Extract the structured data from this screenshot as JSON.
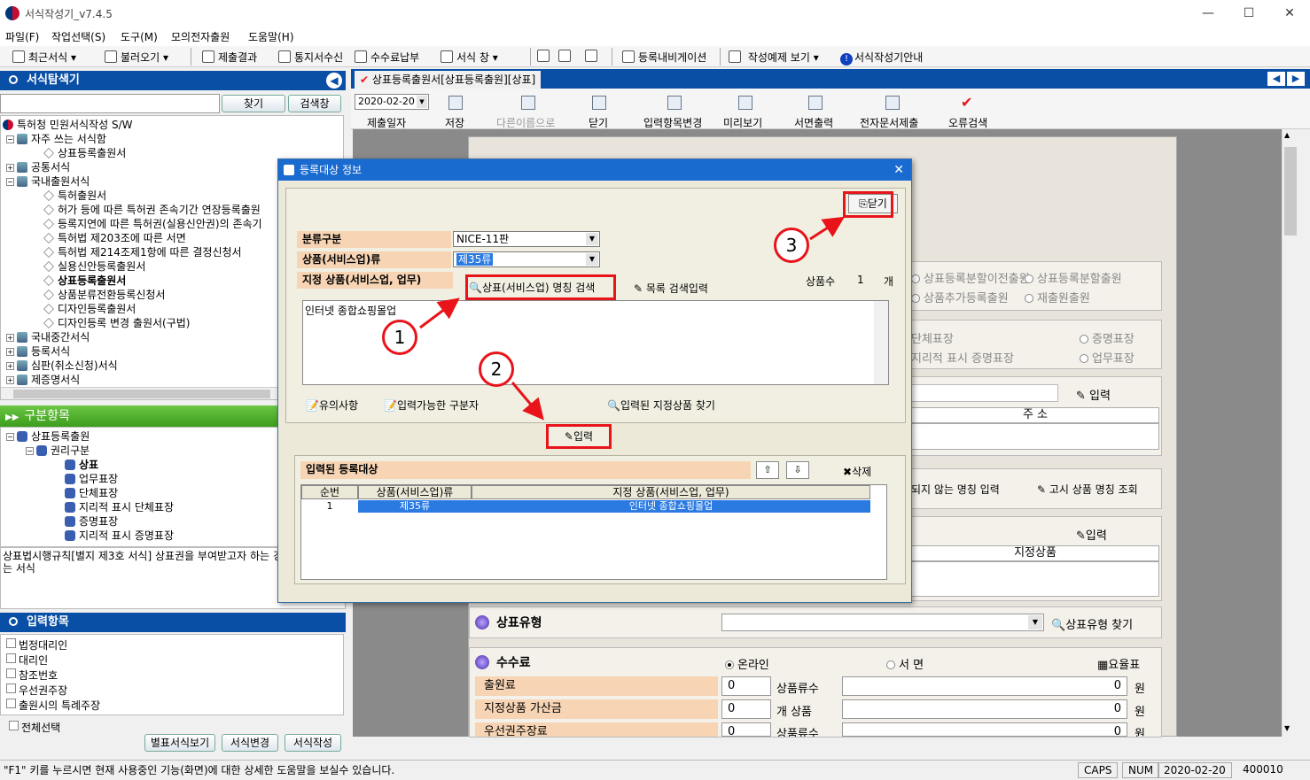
{
  "app": {
    "title": "서식작성기_v7.4.5"
  },
  "window_controls": {
    "minimize": "—",
    "maximize": "☐",
    "close": "✕"
  },
  "menu": [
    "파일(F)",
    "작업선택(S)",
    "도구(M)",
    "모의전자출원",
    "도움말(H)"
  ],
  "toolbar": {
    "recent": "최근서식 ▾",
    "open": "불러오기 ▾",
    "submit_result": "제출결과",
    "notice_receive": "통지서수신",
    "fee_pay": "수수료납부",
    "form_window": "서식 창",
    "nav": "등록내비게이션",
    "example": "작성예제 보기 ▾",
    "guide": "서식작성기안내"
  },
  "explorer": {
    "title": "서식탐색기",
    "find_btn": "찾기",
    "search_btn": "검색창",
    "tree": [
      "특허청 민원서식작성 S/W",
      "자주 쓰는 서식함",
      "상표등록출원서",
      "공통서식",
      "국내출원서식",
      "특허출원서",
      "허가 등에 따른 특허권 존속기간 연장등록출원",
      "등록지연에 따른 특허권(실용신안권)의 존속기",
      "특허법 제203조에 따른 서면",
      "특허법 제214조제1항에 따른 결정신청서",
      "실용신안등록출원서",
      "상표등록출원서",
      "상품분류전환등록신청서",
      "디자인등록출원서",
      "디자인등록 변경 출원서(구법)",
      "국내중간서식",
      "등록서식",
      "심판(취소신청)서식",
      "제증명서식"
    ]
  },
  "category": {
    "title": "구분항목",
    "tree": [
      "상표등록출원",
      "권리구분",
      "상표",
      "업무표장",
      "단체표장",
      "지리적 표시 단체표장",
      "증명표장",
      "지리적 표시 증명표장"
    ],
    "description": "상표법시행규칙[별지 제3호 서식] 상표권을 부여받고자 하는 경우에 제출하는 서식"
  },
  "input_items": {
    "title": "입력항목",
    "items": [
      "법정대리인",
      "대리인",
      "참조번호",
      "우선권주장",
      "출원시의 특례주장"
    ],
    "select_all": "전체선택",
    "btn_attach": "별표서식보기",
    "btn_change": "서식변경",
    "btn_write": "서식작성"
  },
  "document": {
    "tab": "상표등록출원서[상표등록출원][상표]",
    "date": "2020-02-20",
    "toolbar": [
      "제출일자",
      "저장",
      "다른이름으로",
      "닫기",
      "입력항목변경",
      "미리보기",
      "서면출력",
      "전자문서제출",
      "오류검색"
    ],
    "bg_radios1": [
      "상표등록분할이전출원",
      "상표등록분할출원",
      "상품추가등록출원",
      "재출원출원"
    ],
    "bg_radios2": [
      "단체표장",
      "증명표장",
      "지리적 표시 증명표장",
      "업무표장"
    ],
    "bg_input": "입력",
    "bg_address": "주  소",
    "bg_links": [
      "되지 않는 명칭 입력",
      "고시 상품 명칭 조회"
    ],
    "bg_input2": "입력",
    "bg_designated": "지정상품",
    "mark_type": {
      "label": "상표유형",
      "find": "상표유형 찾기"
    },
    "fee": {
      "label": "수수료",
      "online": "온라인",
      "paper": "서  면",
      "table": "요율표",
      "rows": [
        {
          "label": "출원료",
          "count": "0",
          "unit": "상품류수",
          "amount": "0",
          "won": "원"
        },
        {
          "label": "지정상품 가산금",
          "count": "0",
          "unit": "개 상품",
          "amount": "0",
          "won": "원"
        },
        {
          "label": "우선권주장료",
          "count": "0",
          "unit": "상품류수",
          "amount": "0",
          "won": "원"
        }
      ]
    }
  },
  "dialog": {
    "title": "등록대상 정보",
    "close": "닫기",
    "class_label": "분류구분",
    "class_value": "NICE-11판",
    "goods_class_label": "상품(서비스업)류",
    "goods_class_value": "제35류",
    "designated_label": "지정 상품(서비스업, 업무)",
    "name_search": "상표(서비스업) 명칭 검색",
    "list_input": "목록 검색입력",
    "count_label": "상품수",
    "count": "1",
    "count_unit": "개",
    "textarea": "인터넷 종합쇼핑몰업",
    "notes": "유의사항",
    "separators": "입력가능한 구분자",
    "find_entered": "입력된 지정상품 찾기",
    "input_btn": "입력",
    "registered_label": "입력된 등록대상",
    "delete": "삭제",
    "grid_headers": [
      "순번",
      "상품(서비스업)류",
      "지정 상품(서비스업, 업무)"
    ],
    "grid_row": {
      "no": "1",
      "class": "제35류",
      "goods": "인터넷 종합쇼핑몰업"
    },
    "badges": [
      "1",
      "2",
      "3"
    ]
  },
  "status": {
    "help": "\"F1\" 키를 누르시면 현재 사용중인 기능(화면)에 대한 상세한 도움말을 보실수 있습니다.",
    "caps": "CAPS",
    "num": "NUM",
    "date": "2020-02-20",
    "code": "400010"
  },
  "colors": {
    "accent": "#0a4fa6",
    "highlight": "#e8141a",
    "label_bg": "#f6d4b4",
    "selected": "#2a7ae2"
  }
}
